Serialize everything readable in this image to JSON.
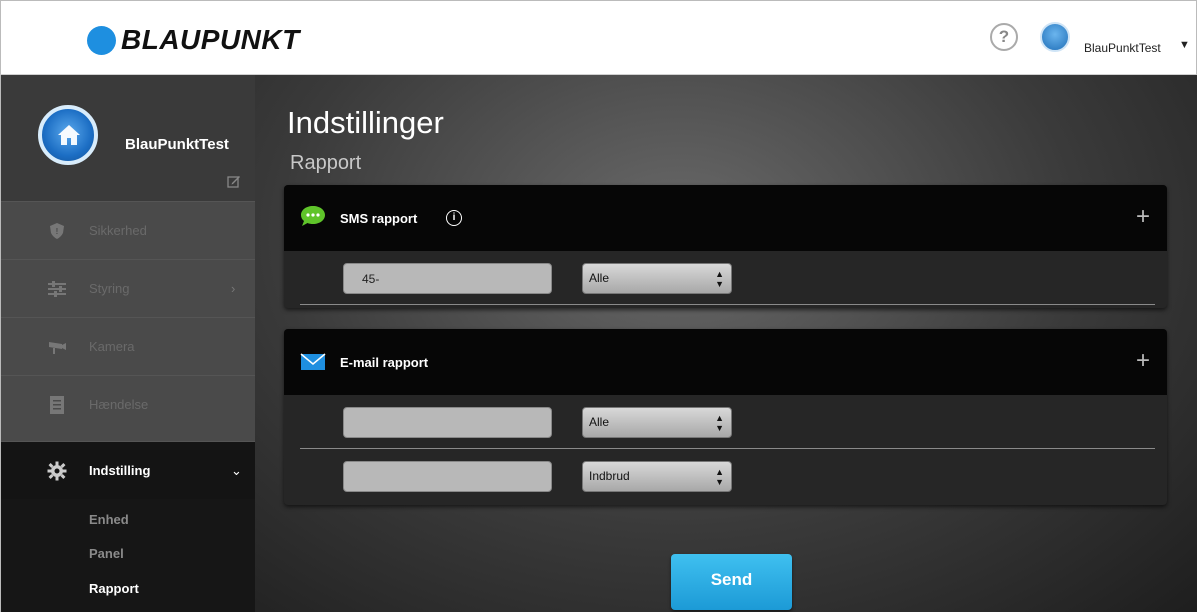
{
  "header": {
    "brand": "BLAUPUNKT",
    "help_glyph": "?",
    "username": "BlauPunktTest",
    "caret": "⌄"
  },
  "sidebar": {
    "profile_name": "BlauPunktTest",
    "items": [
      {
        "label": "Sikkerhed",
        "icon": "shield-icon"
      },
      {
        "label": "Styring",
        "icon": "sliders-icon",
        "chevron": "›"
      },
      {
        "label": "Kamera",
        "icon": "camera-icon"
      },
      {
        "label": "Hændelse",
        "icon": "list-icon"
      },
      {
        "label": "Indstilling",
        "icon": "gear-icon",
        "chevron": "⌄"
      }
    ],
    "subitems": [
      "Enhed",
      "Panel",
      "Rapport"
    ]
  },
  "main": {
    "title": "Indstillinger",
    "subtitle": "Rapport",
    "sms_panel": {
      "label": "SMS rapport",
      "info_glyph": "i",
      "plus": "+",
      "rows": [
        {
          "value": "45-",
          "select": "Alle"
        }
      ]
    },
    "email_panel": {
      "label": "E-mail rapport",
      "plus": "+",
      "rows": [
        {
          "value": "",
          "select": "Alle"
        },
        {
          "value": "",
          "select": "Indbrud"
        }
      ]
    },
    "send_label": "Send"
  },
  "colors": {
    "brand_blue": "#1e8fe0",
    "send_button": "#28aee6",
    "sms_green": "#5fc42a",
    "email_blue": "#1e8fe0"
  }
}
